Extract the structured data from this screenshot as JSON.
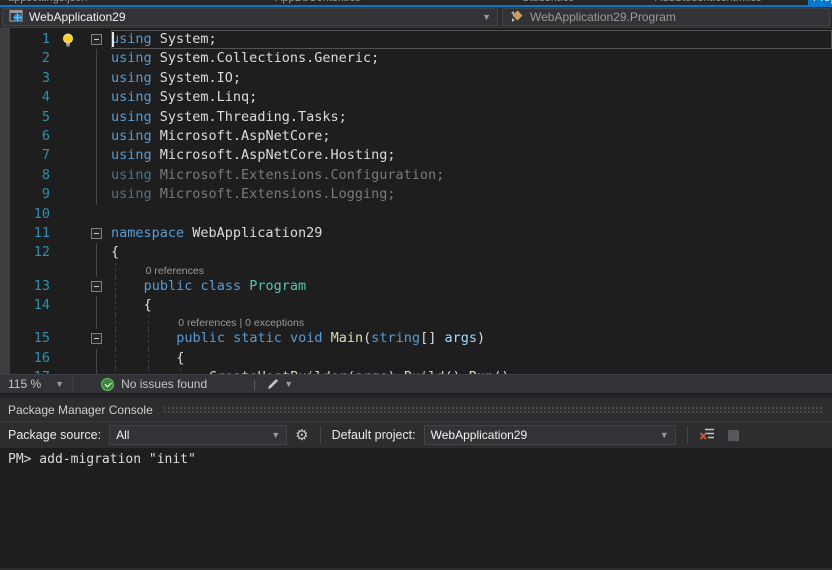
{
  "colors": {
    "accent": "#007acc",
    "editor_background": "#1e1e1e",
    "keyword": "#569cd6",
    "type_name": "#4ec9b0",
    "method_name": "#dcdcaa",
    "parameter": "#9cdcfe",
    "plain_text": "#dcdcdc",
    "dimmed_using": "#7a7a7a",
    "line_number": "#2b91af",
    "codelens_text": "#999999",
    "status_ok_green": "#388a34",
    "lightbulb_yellow": "#fcd116"
  },
  "tab_strip": {
    "tabs": [
      {
        "label": "appsettings.json",
        "active": false
      },
      {
        "label": "AppDbContext.cs",
        "active": false
      },
      {
        "label": "Student.cs",
        "active": false
      },
      {
        "label": "AddStudent.cshtml.cs",
        "active": false
      },
      {
        "label": "Program.cs",
        "active": true
      }
    ]
  },
  "nav_bar": {
    "project_selector": "WebApplication29",
    "type_selector": "WebApplication29.Program"
  },
  "editor": {
    "zoom_level": "115 %",
    "status_message": "No issues found",
    "lines": [
      {
        "num": "1",
        "fold": true,
        "lightbulb": true,
        "caret": true,
        "current": true,
        "tokens": [
          [
            "kw",
            "using "
          ],
          [
            "pl",
            "System;"
          ]
        ]
      },
      {
        "num": "2",
        "fline": true,
        "tokens": [
          [
            "kw",
            "using "
          ],
          [
            "pl",
            "System.Collections.Generic;"
          ]
        ]
      },
      {
        "num": "3",
        "fline": true,
        "tokens": [
          [
            "kw",
            "using "
          ],
          [
            "pl",
            "System.IO;"
          ]
        ]
      },
      {
        "num": "4",
        "fline": true,
        "tokens": [
          [
            "kw",
            "using "
          ],
          [
            "pl",
            "System.Linq;"
          ]
        ]
      },
      {
        "num": "5",
        "fline": true,
        "tokens": [
          [
            "kw",
            "using "
          ],
          [
            "pl",
            "System.Threading.Tasks;"
          ]
        ]
      },
      {
        "num": "6",
        "fline": true,
        "tokens": [
          [
            "kw",
            "using "
          ],
          [
            "pl",
            "Microsoft.AspNetCore;"
          ]
        ]
      },
      {
        "num": "7",
        "fline": true,
        "tokens": [
          [
            "kw",
            "using "
          ],
          [
            "pl",
            "Microsoft.AspNetCore.Hosting;"
          ]
        ]
      },
      {
        "num": "8",
        "fline": true,
        "tokens": [
          [
            "dimkw",
            "using "
          ],
          [
            "dim",
            "Microsoft.Extensions.Configuration;"
          ]
        ]
      },
      {
        "num": "9",
        "fline": true,
        "tokens": [
          [
            "dimkw",
            "using "
          ],
          [
            "dim",
            "Microsoft.Extensions.Logging;"
          ]
        ]
      },
      {
        "num": "10",
        "tokens": []
      },
      {
        "num": "11",
        "fold": true,
        "tokens": [
          [
            "kw",
            "namespace "
          ],
          [
            "pl",
            "WebApplication29"
          ]
        ]
      },
      {
        "num": "12",
        "fline": true,
        "tokens": [
          [
            "pl",
            "{"
          ]
        ]
      },
      {
        "codelens": "0 references",
        "indent": 1,
        "guides": [
          0
        ],
        "fline": true
      },
      {
        "num": "13",
        "fold": true,
        "indent": 1,
        "guides": [
          0
        ],
        "tokens": [
          [
            "kw",
            "public class "
          ],
          [
            "ty",
            "Program"
          ]
        ]
      },
      {
        "num": "14",
        "fline": true,
        "indent": 1,
        "guides": [
          0
        ],
        "tokens": [
          [
            "pl",
            "{"
          ]
        ]
      },
      {
        "codelens": "0 references | 0 exceptions",
        "indent": 2,
        "guides": [
          0,
          1
        ],
        "fline": true
      },
      {
        "num": "15",
        "fold": true,
        "indent": 2,
        "guides": [
          0,
          1
        ],
        "tokens": [
          [
            "kw",
            "public static void "
          ],
          [
            "me",
            "Main"
          ],
          [
            "pl",
            "("
          ],
          [
            "kw",
            "string"
          ],
          [
            "pl",
            "[] "
          ],
          [
            "pa",
            "args"
          ],
          [
            "pl",
            ")"
          ]
        ]
      },
      {
        "num": "16",
        "fline": true,
        "indent": 2,
        "guides": [
          0,
          1
        ],
        "tokens": [
          [
            "pl",
            "{"
          ]
        ]
      },
      {
        "num": "17",
        "fline": true,
        "indent": 3,
        "guides": [
          0,
          1,
          2
        ],
        "tokens": [
          [
            "me",
            "CreateHostBuilder"
          ],
          [
            "pl",
            "(args)."
          ],
          [
            "me",
            "Build"
          ],
          [
            "pl",
            "()."
          ],
          [
            "me",
            "Run"
          ],
          [
            "pl",
            "();"
          ]
        ]
      }
    ]
  },
  "pmc": {
    "title": "Package Manager Console",
    "package_source_label": "Package source:",
    "package_source_value": "All",
    "default_project_label": "Default project:",
    "default_project_value": "WebApplication29",
    "prompt_line": "PM> add-migration \"init\""
  }
}
